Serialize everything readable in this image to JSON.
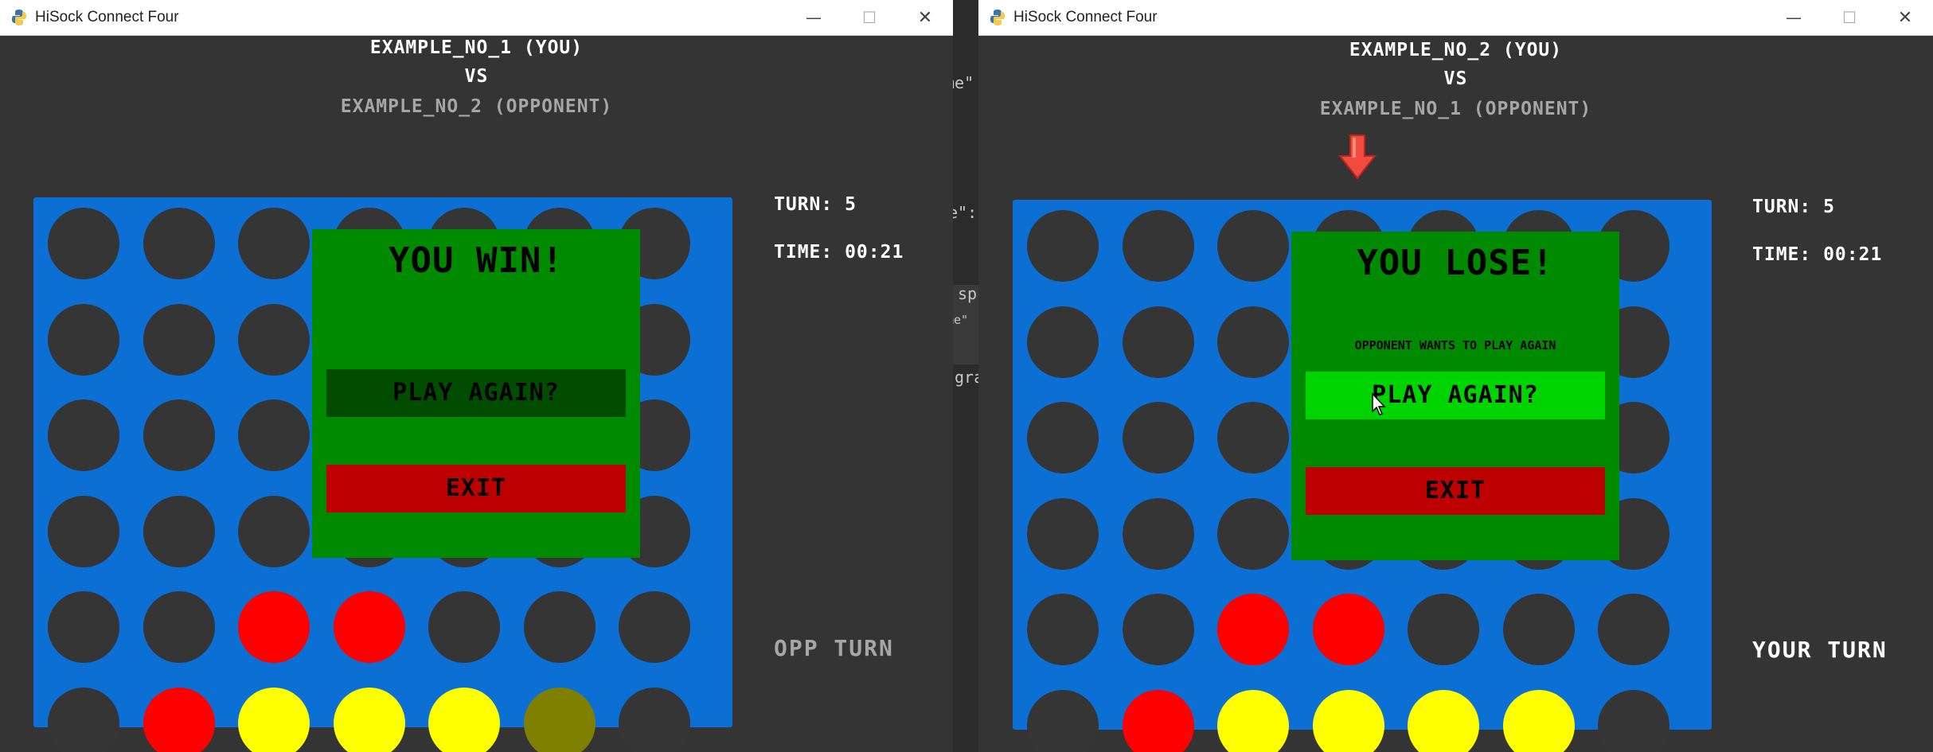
{
  "colors": {
    "window_bg": "#343434",
    "board_blue": "#0c6fd3",
    "empty_slot": "#353535",
    "red_piece": "#ff0000",
    "yellow_piece": "#ffff00",
    "highlight_piece": "#7f7f00",
    "overlay_green": "#008a00",
    "play_again_dim": "#004d00",
    "play_again_active": "#00d400",
    "exit_red": "#bd0000",
    "arrow_red": "#f24a3e"
  },
  "windows": [
    {
      "title": "HiSock Connect Four",
      "icon": "python-icon",
      "controls": {
        "minimize": "—",
        "maximize": "☐",
        "close": "✕"
      },
      "player_self": "EXAMPLE_NO_1 (YOU)",
      "versus": "VS",
      "player_opponent": "EXAMPLE_NO_2 (OPPONENT)",
      "turn_text": "TURN: 5",
      "time_text": "TIME: 00:21",
      "status_text": "OPP TURN",
      "status_color": "#a6a6a6",
      "board": {
        "rows": [
          [
            "empty",
            "empty",
            "empty",
            "empty",
            "empty",
            "empty",
            "empty"
          ],
          [
            "empty",
            "empty",
            "empty",
            "empty",
            "empty",
            "empty",
            "empty"
          ],
          [
            "empty",
            "empty",
            "empty",
            "empty",
            "empty",
            "empty",
            "empty"
          ],
          [
            "empty",
            "empty",
            "empty",
            "empty",
            "empty",
            "empty",
            "empty"
          ],
          [
            "empty",
            "empty",
            "red",
            "red",
            "empty",
            "empty",
            "empty"
          ],
          [
            "empty",
            "red",
            "yellow",
            "yellow",
            "yellow",
            "highlight",
            "empty"
          ]
        ]
      },
      "drop_arrow_column": null,
      "overlay": {
        "title": "YOU WIN!",
        "message": "",
        "play_again_label": "PLAY AGAIN?",
        "play_again_state": "dim",
        "exit_label": "EXIT"
      },
      "show_cursor": false
    },
    {
      "title": "HiSock Connect Four",
      "icon": "python-icon",
      "controls": {
        "minimize": "—",
        "maximize": "☐",
        "close": "✕"
      },
      "player_self": "EXAMPLE_NO_2 (YOU)",
      "versus": "VS",
      "player_opponent": "EXAMPLE_NO_1 (OPPONENT)",
      "turn_text": "TURN: 5",
      "time_text": "TIME: 00:21",
      "status_text": "YOUR TURN",
      "status_color": "#ffffff",
      "board": {
        "rows": [
          [
            "empty",
            "empty",
            "empty",
            "empty",
            "empty",
            "empty",
            "empty"
          ],
          [
            "empty",
            "empty",
            "empty",
            "empty",
            "empty",
            "empty",
            "empty"
          ],
          [
            "empty",
            "empty",
            "empty",
            "empty",
            "empty",
            "empty",
            "empty"
          ],
          [
            "empty",
            "empty",
            "empty",
            "empty",
            "empty",
            "empty",
            "empty"
          ],
          [
            "empty",
            "empty",
            "red",
            "red",
            "empty",
            "empty",
            "empty"
          ],
          [
            "empty",
            "red",
            "yellow",
            "yellow",
            "yellow",
            "yellow",
            "empty"
          ]
        ]
      },
      "drop_arrow_column": 3,
      "overlay": {
        "title": "YOU LOSE!",
        "message": "OPPONENT WANTS TO PLAY AGAIN",
        "play_again_label": "PLAY AGAIN?",
        "play_again_state": "active",
        "exit_label": "EXIT"
      },
      "show_cursor": true
    }
  ],
  "background_fragments": [
    "me\"",
    "e\":",
    "sp",
    "me\"",
    "gra"
  ]
}
